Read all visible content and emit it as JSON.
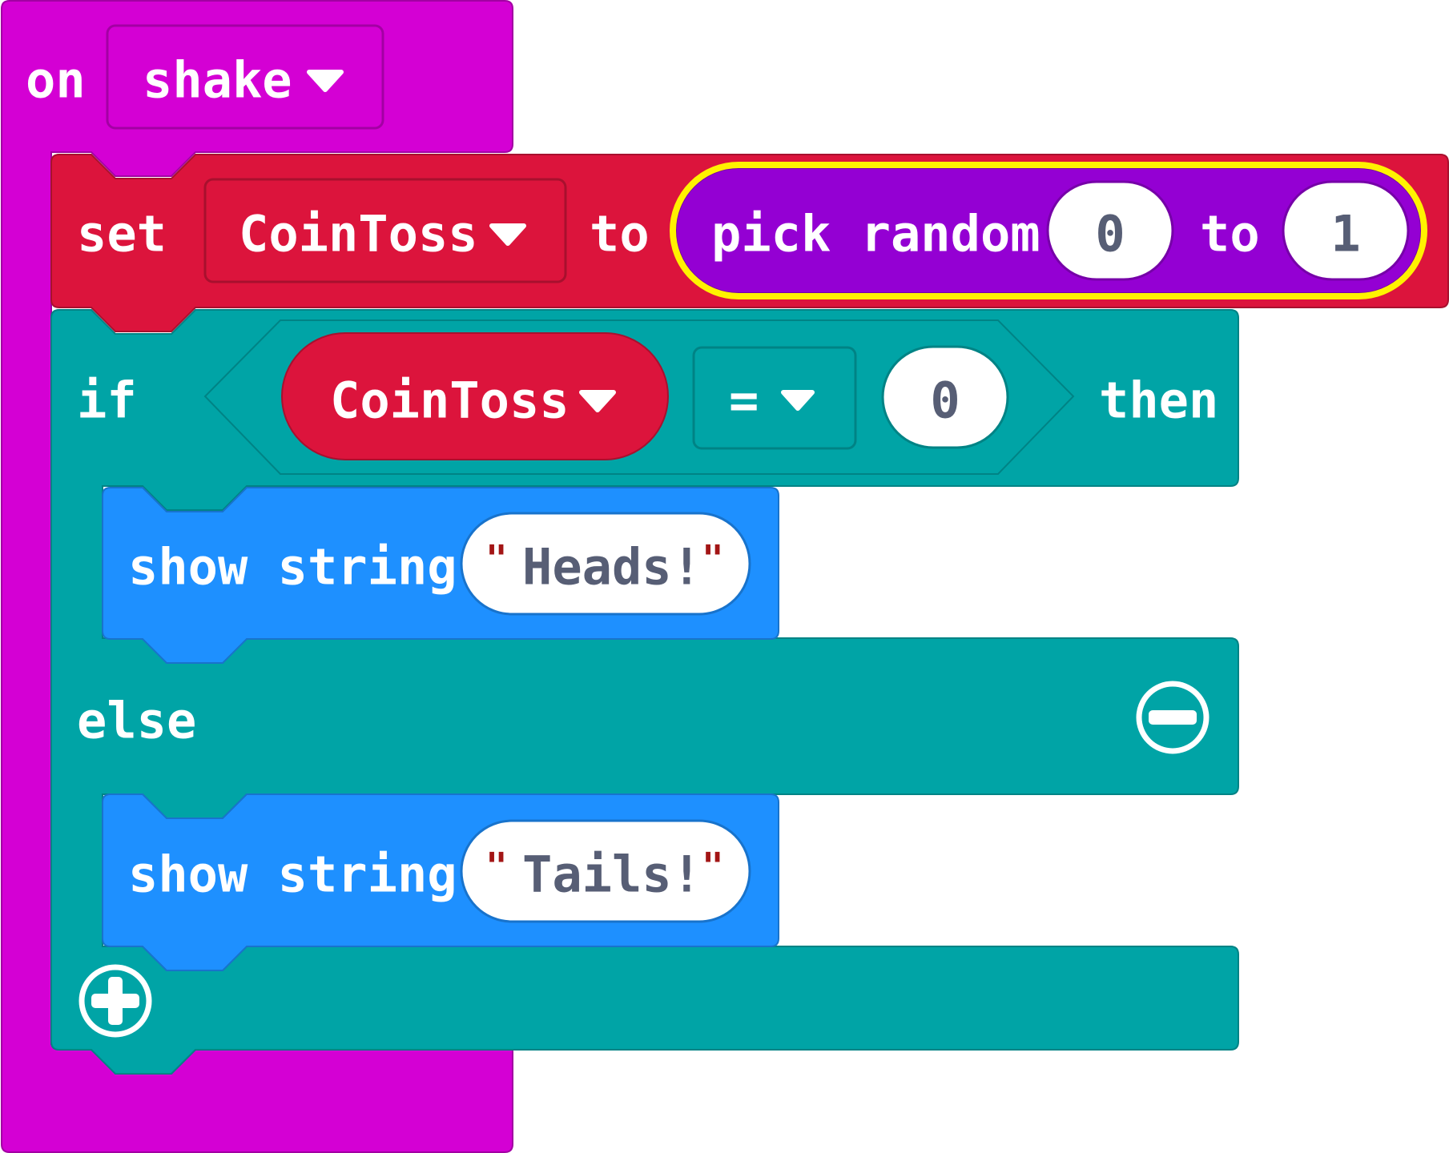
{
  "event_block": {
    "keyword": "on",
    "gesture": "shake"
  },
  "set_block": {
    "keyword": "set",
    "variable": "CoinToss",
    "to_label": "to",
    "random": {
      "label": "pick random",
      "min": "0",
      "to_label": "to",
      "max": "1"
    }
  },
  "if_block": {
    "if_label": "if",
    "condition": {
      "variable": "CoinToss",
      "operator": "=",
      "value": "0"
    },
    "then_label": "then",
    "then_branch": {
      "label": "show string",
      "quote_open": "\"",
      "value": "Heads!",
      "quote_close": "\""
    },
    "else_label": "else",
    "else_branch": {
      "label": "show string",
      "quote_open": "\"",
      "value": "Tails!",
      "quote_close": "\""
    }
  },
  "icons": {
    "remove_else": "minus-circle-icon",
    "add_branch": "plus-circle-icon"
  },
  "colors": {
    "event": "#D400D4",
    "variables": "#DC143C",
    "logic": "#00A4A6",
    "basic": "#1E90FF",
    "math": "#9400D3",
    "selection": "#FFF200"
  }
}
